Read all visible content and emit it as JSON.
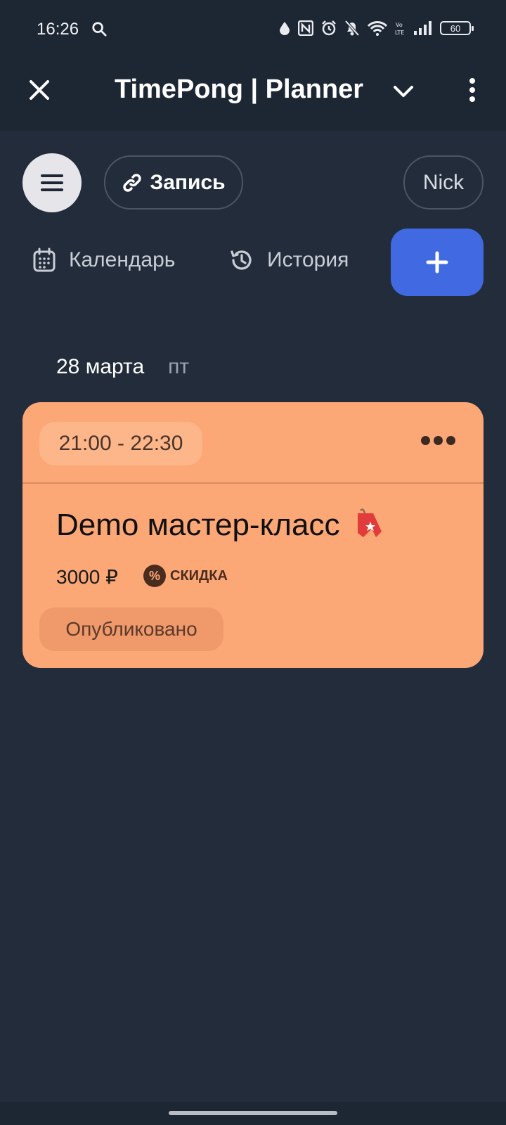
{
  "status_bar": {
    "time": "16:26",
    "battery": "60"
  },
  "app_bar": {
    "title": "TimePong | Planner"
  },
  "toolbar": {
    "record_label": "Запись",
    "user_label": "Nick"
  },
  "tabs": {
    "calendar_label": "Календарь",
    "history_label": "История"
  },
  "day": {
    "date": "28 марта",
    "weekday": "пт"
  },
  "event_card": {
    "time_range": "21:00 - 22:30",
    "title": "Demo мастер-класс",
    "price": "3000 ₽",
    "discount_label": "СКИДКА",
    "status": "Опубликовано",
    "background_color": "#fba776"
  },
  "colors": {
    "accent": "#4169e1",
    "background": "#222c3b"
  }
}
